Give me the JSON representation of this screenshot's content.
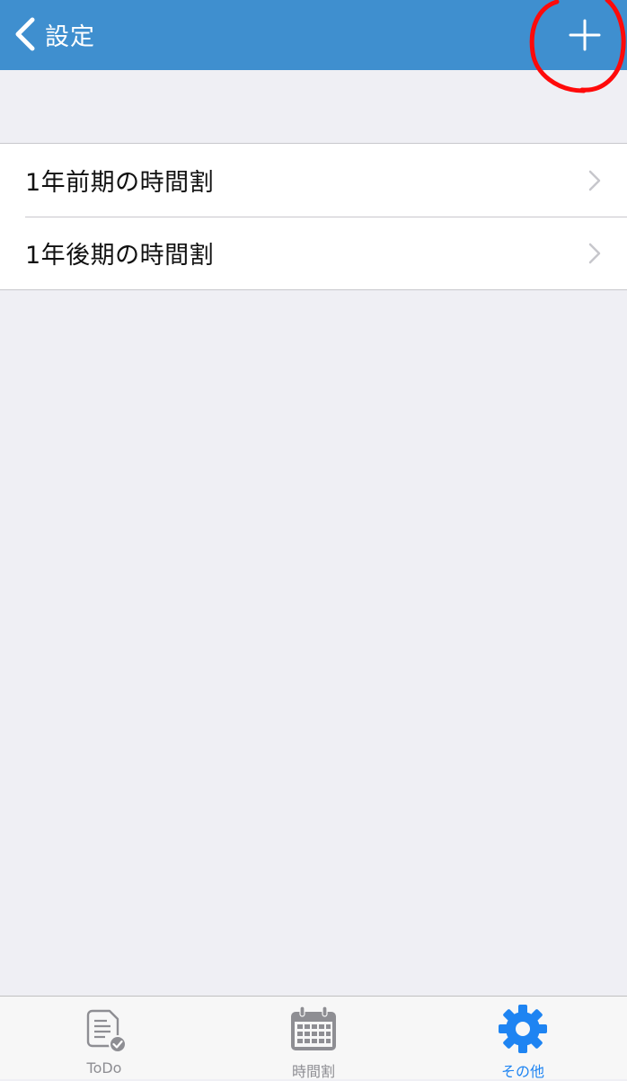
{
  "colors": {
    "nav_background": "#3f8fcf",
    "page_background": "#efeff4",
    "tab_active": "#1e84f2",
    "tab_inactive": "#8e8e93",
    "annotation": "#ff0000"
  },
  "nav": {
    "back_label": "設定",
    "back_icon": "chevron-left-icon",
    "add_icon": "plus-icon"
  },
  "list": {
    "items": [
      {
        "label": "1年前期の時間割",
        "icon": "chevron-right-icon"
      },
      {
        "label": "1年後期の時間割",
        "icon": "chevron-right-icon"
      }
    ]
  },
  "tabs": [
    {
      "label": "ToDo",
      "icon": "todo-document-check-icon",
      "active": false
    },
    {
      "label": "時間割",
      "icon": "calendar-icon",
      "active": false
    },
    {
      "label": "その他",
      "icon": "gear-icon",
      "active": true
    }
  ]
}
